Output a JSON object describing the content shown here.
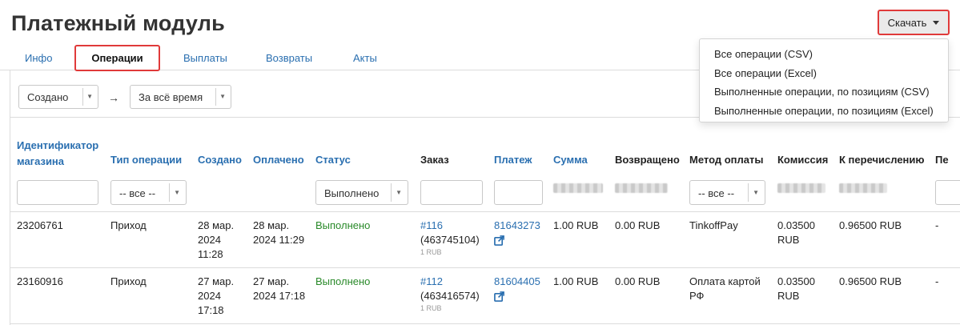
{
  "page": {
    "title": "Платежный модуль"
  },
  "download": {
    "label": "Скачать",
    "menu": [
      "Все операции (CSV)",
      "Все операции (Excel)",
      "Выполненные операции, по позициям (CSV)",
      "Выполненные операции, по позициям (Excel)"
    ]
  },
  "tabs": [
    "Инфо",
    "Операции",
    "Выплаты",
    "Возвраты",
    "Акты"
  ],
  "active_tab": "Операции",
  "filters": {
    "date_field": "Создано",
    "arrow": "→",
    "period": "За всё время"
  },
  "table": {
    "headers": {
      "shop_id_line1": "Идентификатор",
      "shop_id_line2": "магазина",
      "op_type": "Тип операции",
      "created": "Создано",
      "paid": "Оплачено",
      "status": "Статус",
      "order": "Заказ",
      "payment": "Платеж",
      "amount": "Сумма",
      "refunded": "Возвращено",
      "method": "Метод оплаты",
      "commission": "Комиссия",
      "payout": "К перечислению",
      "next": "Пе"
    },
    "column_filters": {
      "op_type": "-- все --",
      "status": "Выполнено",
      "method": "-- все --"
    },
    "rows": [
      {
        "shop_id": "23206761",
        "op_type": "Приход",
        "created": [
          "28 мар.",
          "2024",
          "11:28"
        ],
        "paid": [
          "28 мар.",
          "2024 11:29"
        ],
        "status": "Выполнено",
        "order_link": "#116",
        "order_id": "(463745104)",
        "order_sum": "1 RUB",
        "payment": "81643273",
        "amount": "1.00 RUB",
        "refunded": "0.00 RUB",
        "method": [
          "TinkoffPay"
        ],
        "commission": [
          "0.03500",
          "RUB"
        ],
        "payout": "0.96500 RUB",
        "next": "-"
      },
      {
        "shop_id": "23160916",
        "op_type": "Приход",
        "created": [
          "27 мар.",
          "2024",
          "17:18"
        ],
        "paid": [
          "27 мар.",
          "2024 17:18"
        ],
        "status": "Выполнено",
        "order_link": "#112",
        "order_id": "(463416574)",
        "order_sum": "1 RUB",
        "payment": "81604405",
        "amount": "1.00 RUB",
        "refunded": "0.00 RUB",
        "method": [
          "Оплата картой",
          "РФ"
        ],
        "commission": [
          "0.03500",
          "RUB"
        ],
        "payout": "0.96500 RUB",
        "next": "-"
      }
    ]
  },
  "colors": {
    "link": "#2a6fb0",
    "success": "#2a8a2a",
    "highlight": "#e03a3a"
  }
}
